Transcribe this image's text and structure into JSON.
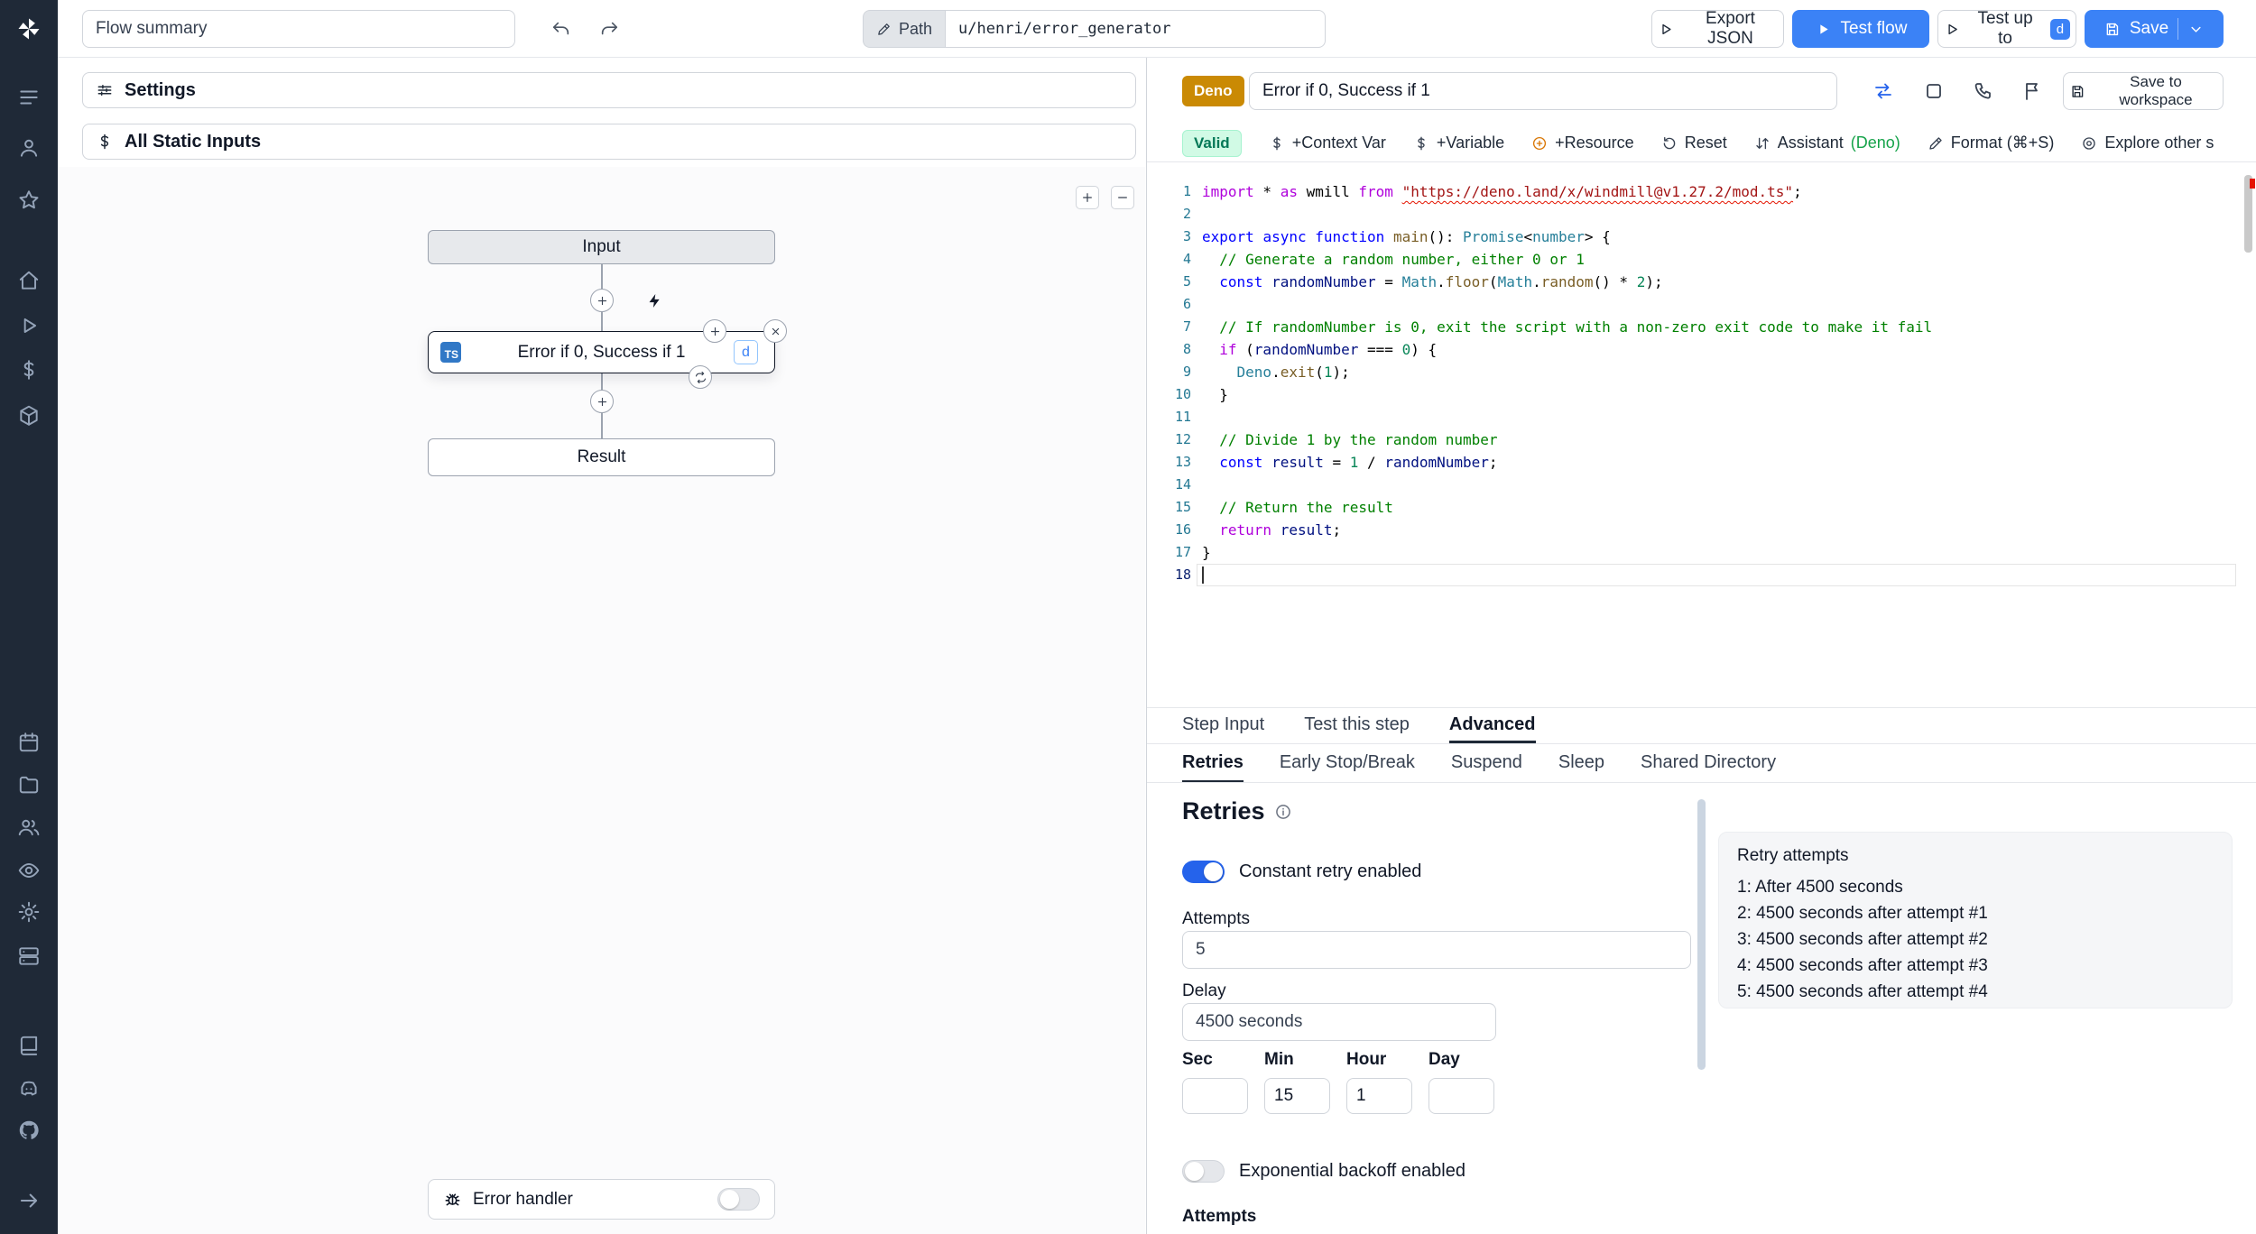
{
  "topbar": {
    "flow_summary_value": "Flow summary",
    "path_label": "Path",
    "path_value": "u/henri/error_generator",
    "export_json_label": "Export JSON",
    "test_flow_label": "Test flow",
    "test_up_to_label": "Test up to",
    "test_up_to_shortcut": "d",
    "save_label": "Save"
  },
  "sidebar": {
    "items": [
      {
        "icon": "list"
      },
      {
        "icon": "user"
      },
      {
        "icon": "star"
      },
      {
        "icon": "home"
      },
      {
        "icon": "play"
      },
      {
        "icon": "dollar"
      },
      {
        "icon": "cube"
      },
      {
        "icon": "calendar"
      },
      {
        "icon": "folder"
      },
      {
        "icon": "users"
      },
      {
        "icon": "eye"
      },
      {
        "icon": "gear"
      },
      {
        "icon": "server"
      },
      {
        "icon": "book"
      },
      {
        "icon": "discord"
      },
      {
        "icon": "github"
      },
      {
        "icon": "arrow-right"
      }
    ]
  },
  "flow": {
    "settings_label": "Settings",
    "static_inputs_label": "All Static Inputs",
    "input_node": "Input",
    "step_node": {
      "title": "Error if 0, Success if 1",
      "lang_badge": "TS",
      "shortcut_badge": "d"
    },
    "result_node": "Result",
    "error_handler_label": "Error handler"
  },
  "step_editor": {
    "lang_badge": "Deno",
    "name_value": "Error if 0, Success if 1",
    "save_to_workspace_label": "Save to workspace",
    "toolbar": {
      "valid_label": "Valid",
      "context_var": "+Context Var",
      "variable": "+Variable",
      "resource": "+Resource",
      "reset": "Reset",
      "assistant": "Assistant",
      "assistant_lang": "(Deno)",
      "format": "Format (⌘+S)",
      "explore": "Explore other s"
    }
  },
  "editor": {
    "active_line": 18,
    "lines": [
      {
        "num": 1,
        "segments": [
          [
            "ctrl",
            "import"
          ],
          [
            "plain",
            " * "
          ],
          [
            "ctrl",
            "as"
          ],
          [
            "plain",
            " wmill "
          ],
          [
            "ctrl",
            "from"
          ],
          [
            "plain",
            " "
          ],
          [
            "str-err",
            "\"https://deno.land/x/windmill@v1.27.2/mod.ts\""
          ],
          [
            "plain",
            ";"
          ]
        ]
      },
      {
        "num": 2,
        "segments": []
      },
      {
        "num": 3,
        "segments": [
          [
            "kw",
            "export"
          ],
          [
            "plain",
            " "
          ],
          [
            "kw",
            "async"
          ],
          [
            "plain",
            " "
          ],
          [
            "kw",
            "function"
          ],
          [
            "plain",
            " "
          ],
          [
            "fn",
            "main"
          ],
          [
            "plain",
            "(): "
          ],
          [
            "type",
            "Promise"
          ],
          [
            "plain",
            "<"
          ],
          [
            "type",
            "number"
          ],
          [
            "plain",
            "> {"
          ]
        ]
      },
      {
        "num": 4,
        "segments": [
          [
            "comment",
            "  // Generate a random number, either 0 or 1"
          ]
        ]
      },
      {
        "num": 5,
        "segments": [
          [
            "plain",
            "  "
          ],
          [
            "kw",
            "const"
          ],
          [
            "plain",
            " "
          ],
          [
            "var",
            "randomNumber"
          ],
          [
            "plain",
            " = "
          ],
          [
            "type",
            "Math"
          ],
          [
            "plain",
            "."
          ],
          [
            "fn",
            "floor"
          ],
          [
            "plain",
            "("
          ],
          [
            "type",
            "Math"
          ],
          [
            "plain",
            "."
          ],
          [
            "fn",
            "random"
          ],
          [
            "plain",
            "() * "
          ],
          [
            "num",
            "2"
          ],
          [
            "plain",
            ");"
          ]
        ]
      },
      {
        "num": 6,
        "segments": []
      },
      {
        "num": 7,
        "segments": [
          [
            "comment",
            "  // If randomNumber is 0, exit the script with a non-zero exit code to make it fail"
          ]
        ]
      },
      {
        "num": 8,
        "segments": [
          [
            "plain",
            "  "
          ],
          [
            "ctrl",
            "if"
          ],
          [
            "plain",
            " ("
          ],
          [
            "var",
            "randomNumber"
          ],
          [
            "plain",
            " === "
          ],
          [
            "num",
            "0"
          ],
          [
            "plain",
            ") {"
          ]
        ]
      },
      {
        "num": 9,
        "segments": [
          [
            "plain",
            "    "
          ],
          [
            "type",
            "Deno"
          ],
          [
            "plain",
            "."
          ],
          [
            "fn",
            "exit"
          ],
          [
            "plain",
            "("
          ],
          [
            "num",
            "1"
          ],
          [
            "plain",
            ");"
          ]
        ]
      },
      {
        "num": 10,
        "segments": [
          [
            "plain",
            "  }"
          ]
        ]
      },
      {
        "num": 11,
        "segments": []
      },
      {
        "num": 12,
        "segments": [
          [
            "comment",
            "  // Divide 1 by the random number"
          ]
        ]
      },
      {
        "num": 13,
        "segments": [
          [
            "plain",
            "  "
          ],
          [
            "kw",
            "const"
          ],
          [
            "plain",
            " "
          ],
          [
            "var",
            "result"
          ],
          [
            "plain",
            " = "
          ],
          [
            "num",
            "1"
          ],
          [
            "plain",
            " / "
          ],
          [
            "var",
            "randomNumber"
          ],
          [
            "plain",
            ";"
          ]
        ]
      },
      {
        "num": 14,
        "segments": []
      },
      {
        "num": 15,
        "segments": [
          [
            "comment",
            "  // Return the result"
          ]
        ]
      },
      {
        "num": 16,
        "segments": [
          [
            "plain",
            "  "
          ],
          [
            "ctrl",
            "return"
          ],
          [
            "plain",
            " "
          ],
          [
            "var",
            "result"
          ],
          [
            "plain",
            ";"
          ]
        ]
      },
      {
        "num": 17,
        "segments": [
          [
            "plain",
            "}"
          ]
        ]
      },
      {
        "num": 18,
        "segments": []
      }
    ]
  },
  "tabs": {
    "items": [
      "Step Input",
      "Test this step",
      "Advanced"
    ],
    "active": "Advanced"
  },
  "subtabs": {
    "items": [
      "Retries",
      "Early Stop/Break",
      "Suspend",
      "Sleep",
      "Shared Directory"
    ],
    "active": "Retries"
  },
  "retries": {
    "title": "Retries",
    "constant_toggle_label": "Constant retry enabled",
    "constant_toggle_on": true,
    "attempts_label": "Attempts",
    "attempts_value": "5",
    "delay_label": "Delay",
    "delay_value": "4500 seconds",
    "time_fields": [
      {
        "label": "Sec",
        "value": ""
      },
      {
        "label": "Min",
        "value": "15"
      },
      {
        "label": "Hour",
        "value": "1"
      },
      {
        "label": "Day",
        "value": ""
      }
    ],
    "exponential_toggle_label": "Exponential backoff enabled",
    "exponential_toggle_on": false,
    "bottom_label": "Attempts",
    "summary_card": {
      "title": "Retry attempts",
      "lines": [
        "1: After 4500 seconds",
        "2: 4500 seconds after attempt #1",
        "3: 4500 seconds after attempt #2",
        "4: 4500 seconds after attempt #3",
        "5: 4500 seconds after attempt #4"
      ]
    }
  },
  "colors": {
    "accent_blue": "#3b82f6",
    "deno_badge": "#ca8a04",
    "valid_green": "#047857"
  }
}
